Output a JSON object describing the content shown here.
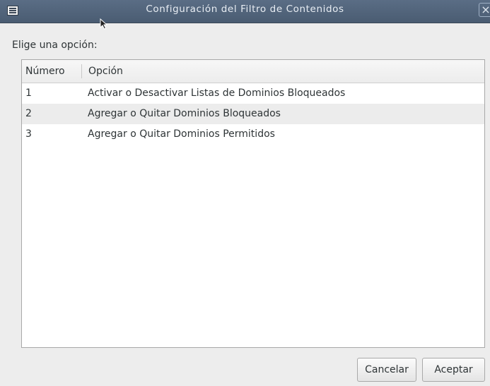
{
  "window": {
    "title": "Configuración del Filtro de Contenidos",
    "close_glyph": "×"
  },
  "prompt": "Elige una opción:",
  "list": {
    "columns": [
      "Número",
      "Opción"
    ],
    "rows": [
      {
        "num": "1",
        "option": "Activar o Desactivar Listas de Dominios Bloqueados"
      },
      {
        "num": "2",
        "option": "Agregar o Quitar Dominios Bloqueados"
      },
      {
        "num": "3",
        "option": "Agregar o Quitar Dominios Permitidos"
      }
    ]
  },
  "buttons": {
    "cancel": "Cancelar",
    "accept": "Aceptar"
  },
  "icons": {
    "menu": "menu-icon",
    "close": "close-icon",
    "cursor": "cursor-icon"
  },
  "colors": {
    "titlebar": "#4f6179",
    "selected_row": "#ececec"
  }
}
